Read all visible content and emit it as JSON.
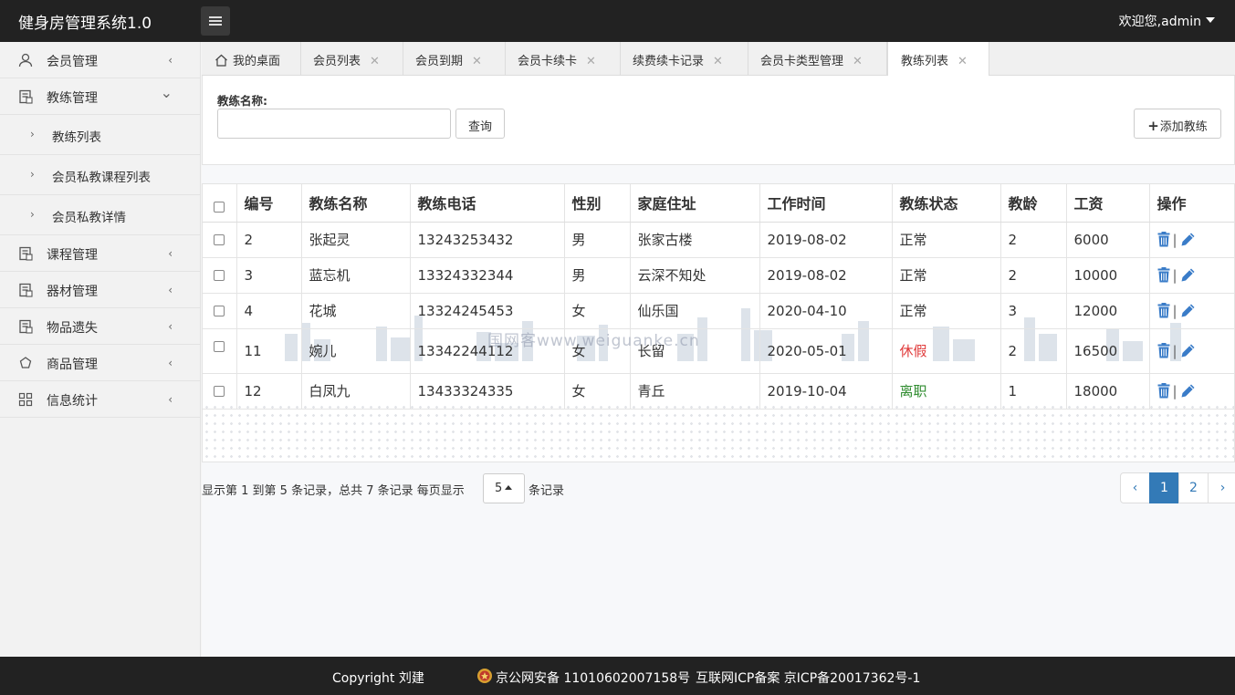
{
  "app": {
    "title": "健身房管理系统1.0",
    "welcome": "欢迎您,admin"
  },
  "sidebar": {
    "items": [
      {
        "label": "会员管理",
        "icon": "user-icon",
        "chev": "‹"
      },
      {
        "label": "教练管理",
        "icon": "clipboard-icon",
        "chev": "⌄"
      },
      {
        "label": "课程管理",
        "icon": "clipboard-icon",
        "chev": "‹"
      },
      {
        "label": "器材管理",
        "icon": "clipboard-icon",
        "chev": "‹"
      },
      {
        "label": "物品遗失",
        "icon": "clipboard-icon",
        "chev": "‹"
      },
      {
        "label": "商品管理",
        "icon": "refresh-icon",
        "chev": "‹"
      },
      {
        "label": "信息统计",
        "icon": "grid-icon",
        "chev": "‹"
      }
    ],
    "sub": [
      {
        "label": "教练列表"
      },
      {
        "label": "会员私教课程列表"
      },
      {
        "label": "会员私教详情"
      }
    ]
  },
  "tabs": [
    {
      "label": "我的桌面"
    },
    {
      "label": "会员列表"
    },
    {
      "label": "会员到期"
    },
    {
      "label": "会员卡续卡"
    },
    {
      "label": "续费续卡记录"
    },
    {
      "label": "会员卡类型管理"
    },
    {
      "label": "教练列表"
    }
  ],
  "filter": {
    "label": "教练名称:",
    "value": "",
    "query_label": "查询",
    "add_label": "添加教练"
  },
  "table": {
    "headers": [
      "编号",
      "教练名称",
      "教练电话",
      "性别",
      "家庭住址",
      "工作时间",
      "教练状态",
      "教龄",
      "工资",
      "操作"
    ],
    "rows": [
      {
        "id": "2",
        "name": "张起灵",
        "phone": "13243253432",
        "gender": "男",
        "address": "张家古楼",
        "date": "2019-08-02",
        "status": "正常",
        "years": "2",
        "salary": "6000"
      },
      {
        "id": "3",
        "name": "蓝忘机",
        "phone": "13324332344",
        "gender": "男",
        "address": "云深不知处",
        "date": "2019-08-02",
        "status": "正常",
        "years": "2",
        "salary": "10000"
      },
      {
        "id": "4",
        "name": "花城",
        "phone": "13324245453",
        "gender": "女",
        "address": "仙乐国",
        "date": "2020-04-10",
        "status": "正常",
        "years": "3",
        "salary": "12000"
      },
      {
        "id": "11",
        "name": "婉儿",
        "phone": "13342244112",
        "gender": "女",
        "address": "长留",
        "date": "2020-05-01",
        "status": "休假",
        "years": "2",
        "salary": "16500"
      },
      {
        "id": "12",
        "name": "白凤九",
        "phone": "13433324335",
        "gender": "女",
        "address": "青丘",
        "date": "2019-10-04",
        "status": "离职",
        "years": "1",
        "salary": "18000"
      }
    ],
    "op_separator": "|"
  },
  "pager": {
    "info_prefix": "显示第 1 到第 5 条记录，总共 7 条记录 每页显示",
    "page_size": "5",
    "info_suffix": "条记录",
    "prev": "‹",
    "pages": [
      "1",
      "2"
    ],
    "next": "›",
    "current": "1"
  },
  "footer": {
    "copyright": "Copyright 刘建",
    "police": "京公网安备 11010602007158号",
    "icp": "互联网ICP备案 京ICP备20017362号-1"
  },
  "watermark": "国网客www.weiguanke.cn",
  "colors": {
    "primary": "#337ab7",
    "vacation": "#e03a3a",
    "resigned": "#2e8b2e",
    "header_bg": "#222222"
  }
}
